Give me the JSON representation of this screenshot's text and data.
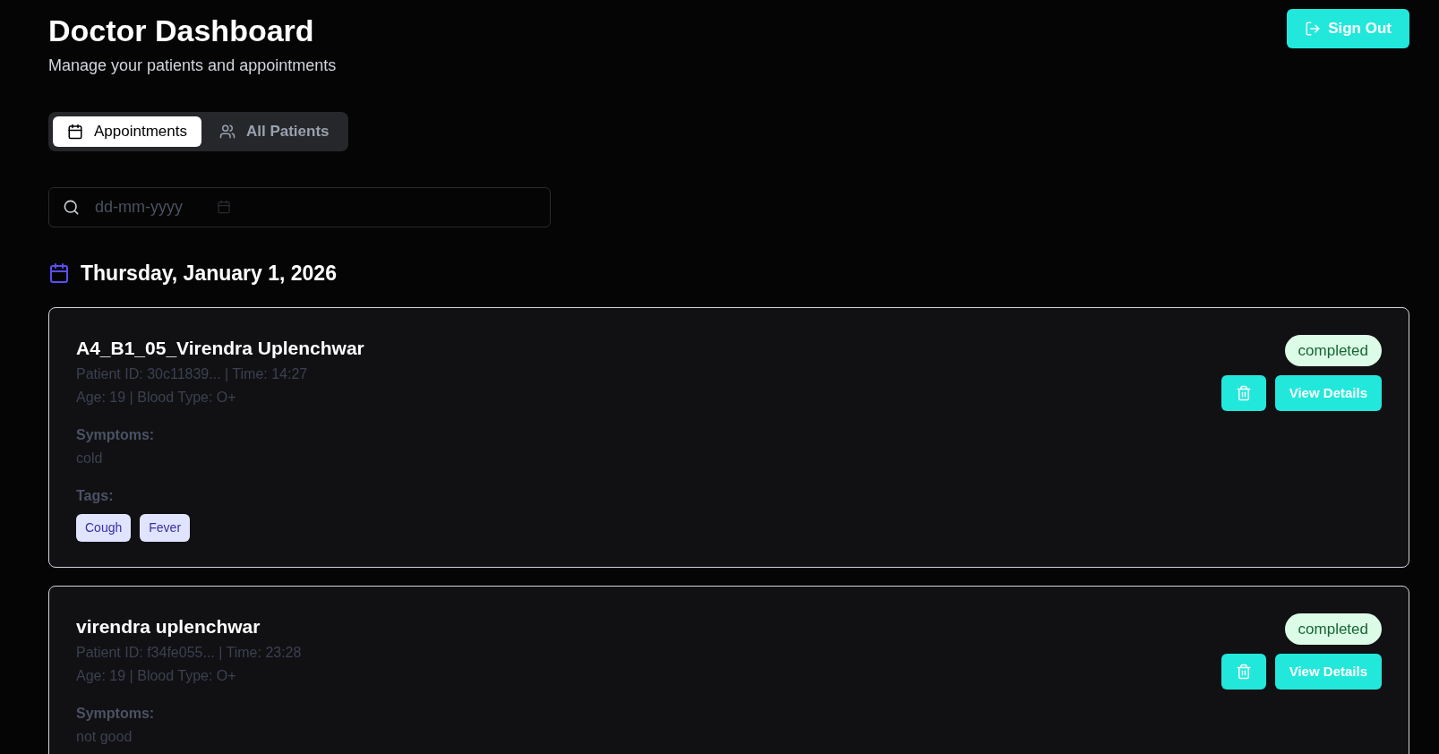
{
  "header": {
    "title": "Doctor Dashboard",
    "subtitle": "Manage your patients and appointments",
    "sign_out": "Sign Out"
  },
  "tabs": [
    {
      "label": "Appointments",
      "selected": true,
      "kind": "calendar"
    },
    {
      "label": "All Patients",
      "selected": false,
      "kind": "users"
    }
  ],
  "date_filter": {
    "placeholder": "dd-mm-yyyy"
  },
  "date_heading": "Thursday, January 1, 2026",
  "appointments": [
    {
      "name": "A4_B1_05_Virendra Uplenchwar",
      "meta": "Patient ID: 30c11839... | Time: 14:27",
      "details": "Age: 19 | Blood Type: O+",
      "symptoms_label": "Symptoms:",
      "symptoms": "cold",
      "tags_label": "Tags:",
      "tags": [
        "Cough",
        "Fever"
      ],
      "status": "completed",
      "view": "View Details"
    },
    {
      "name": "virendra uplenchwar",
      "meta": "Patient ID: f34fe055... | Time: 23:28",
      "details": "Age: 19 | Blood Type: O+",
      "symptoms_label": "Symptoms:",
      "symptoms": "not good",
      "status": "completed",
      "view": "View Details"
    }
  ]
}
